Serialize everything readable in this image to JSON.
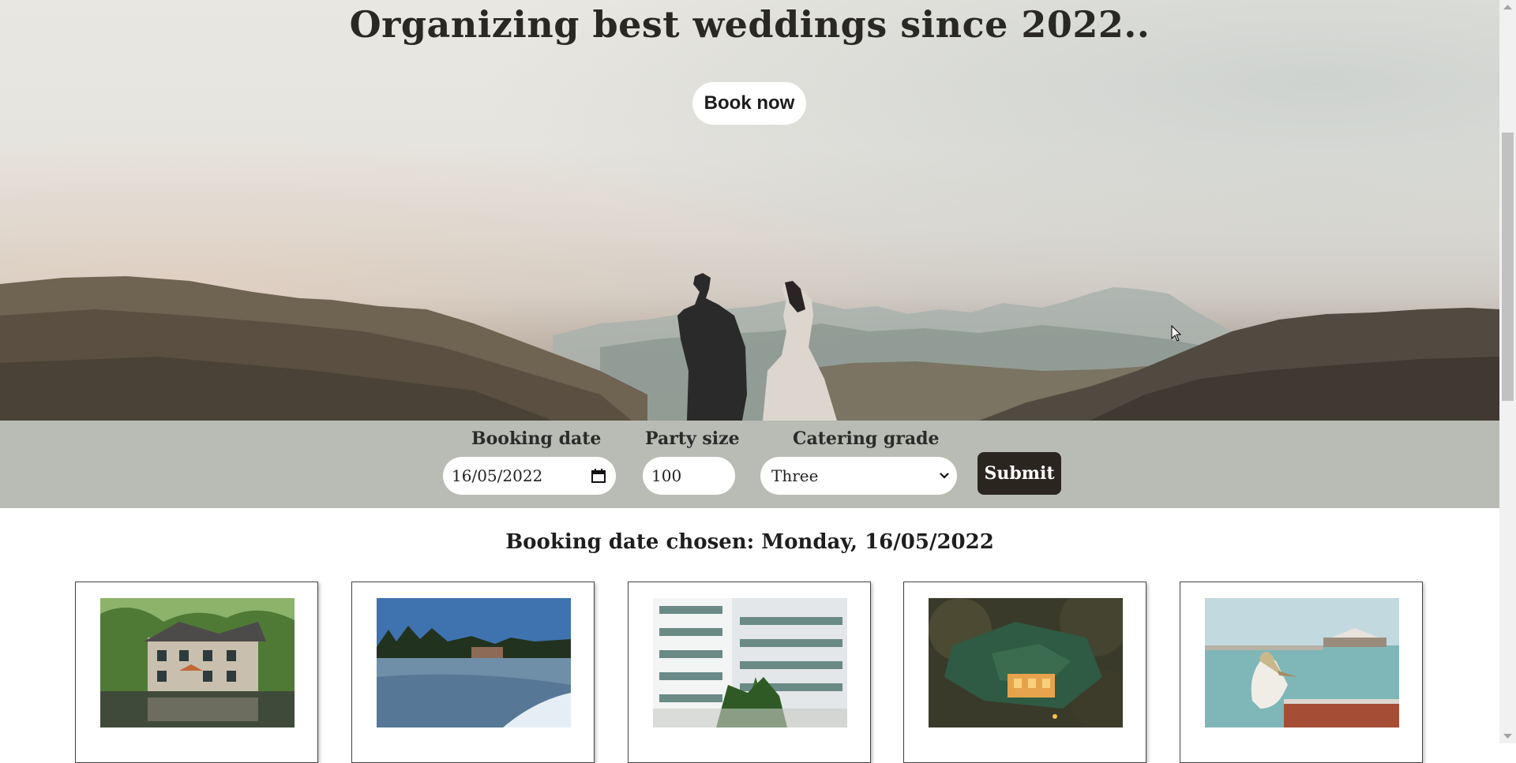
{
  "hero": {
    "title": "Organizing best weddings since 2022..",
    "book_label": "Book now"
  },
  "form": {
    "date_label": "Booking date",
    "date_value": "16/05/2022",
    "party_label": "Party size",
    "party_value": "100",
    "catering_label": "Catering grade",
    "catering_value": "Three",
    "submit_label": "Submit"
  },
  "chosen_text": "Booking date chosen: Monday, 16/05/2022",
  "venues": [
    {
      "image": "lakeside-manor-photo"
    },
    {
      "image": "frozen-lake-photo"
    },
    {
      "image": "white-hotel-palms-photo"
    },
    {
      "image": "forest-lodge-night-photo"
    },
    {
      "image": "pelican-pier-photo"
    }
  ],
  "colors": {
    "form_bar": "#b9bcb4",
    "submit_bg": "#2b2520",
    "page_bg": "#ffffff"
  }
}
